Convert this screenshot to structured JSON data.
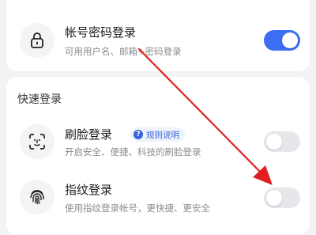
{
  "account_login": {
    "title": "帐号密码登录",
    "description": "可用用户名、邮箱+密码登录",
    "toggle_on": true,
    "icon": "lock-icon"
  },
  "quick_login": {
    "section_title": "快速登录",
    "face": {
      "title": "刷脸登录",
      "badge": "规则说明",
      "badge_icon": "question-icon",
      "description": "开启安全、便捷、科技的刷脸登录",
      "toggle_on": false,
      "icon": "face-scan-icon"
    },
    "fingerprint": {
      "title": "指纹登录",
      "description": "使用指纹登录帐号，更快捷、更安全",
      "toggle_on": false,
      "icon": "fingerprint-icon"
    }
  },
  "colors": {
    "accent": "#3b6ef3",
    "annotation_arrow": "#e02020"
  }
}
